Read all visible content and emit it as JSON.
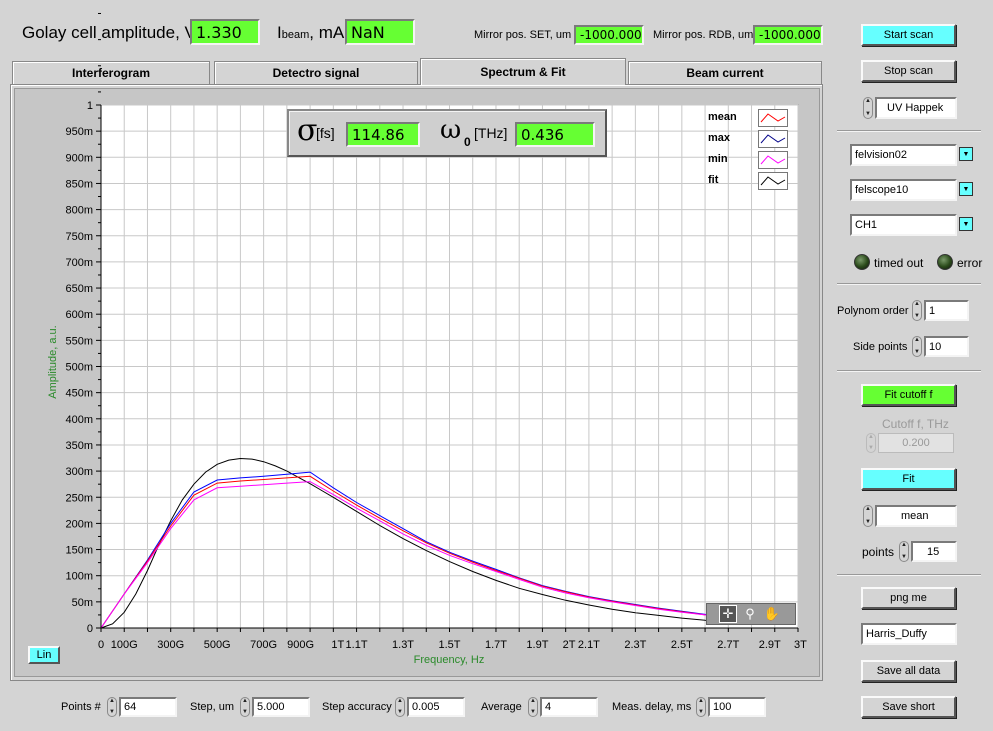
{
  "header": {
    "golay_label": "Golay cell amplitude, V",
    "golay_value": "1.330",
    "ibeam_main": "I",
    "ibeam_sub": "beam",
    "ibeam_unit": ", mA",
    "ibeam_value": "NaN",
    "mirror_set_label": "Mirror pos. SET, um",
    "mirror_set_value": "-1000.000",
    "mirror_rdb_label": "Mirror pos. RDB, um",
    "mirror_rdb_value": "-1000.000"
  },
  "tabs": [
    {
      "label": "Interferogram"
    },
    {
      "label": "Detectro signal"
    },
    {
      "label": "Spectrum & Fit"
    },
    {
      "label": "Beam current"
    }
  ],
  "fit_box": {
    "sigma_symbol": "σ",
    "sigma_unit": "[fs]",
    "sigma_value": "114.86",
    "omega_symbol": "ω",
    "omega_sub": "0",
    "omega_unit": "[THz]",
    "omega_value": "0.436"
  },
  "legend": [
    {
      "name": "mean",
      "color": "#ff0000"
    },
    {
      "name": "max",
      "color": "#0000ff"
    },
    {
      "name": "min",
      "color": "#ff00ff"
    },
    {
      "name": "fit",
      "color": "#000000"
    }
  ],
  "scale_button": "Lin",
  "chart_data": {
    "type": "line",
    "xlabel": "Frequency, Hz",
    "ylabel": "Amplitude, a.u.",
    "xlim": [
      0,
      3.0
    ],
    "ylim": [
      0,
      1.0
    ],
    "grid": true,
    "legend_position": "top-right",
    "x_ticks": [
      {
        "v": 0,
        "label": "0"
      },
      {
        "v": 0.1,
        "label": "100G"
      },
      {
        "v": 0.3,
        "label": "300G"
      },
      {
        "v": 0.5,
        "label": "500G"
      },
      {
        "v": 0.7,
        "label": "700G"
      },
      {
        "v": 0.9,
        "label": "900G"
      },
      {
        "v": 1.0,
        "label": "1T"
      },
      {
        "v": 1.1,
        "label": "1.1T"
      },
      {
        "v": 1.3,
        "label": "1.3T"
      },
      {
        "v": 1.5,
        "label": "1.5T"
      },
      {
        "v": 1.7,
        "label": "1.7T"
      },
      {
        "v": 1.9,
        "label": "1.9T"
      },
      {
        "v": 2.0,
        "label": "2T"
      },
      {
        "v": 2.1,
        "label": "2.1T"
      },
      {
        "v": 2.3,
        "label": "2.3T"
      },
      {
        "v": 2.5,
        "label": "2.5T"
      },
      {
        "v": 2.7,
        "label": "2.7T"
      },
      {
        "v": 2.9,
        "label": "2.9T"
      },
      {
        "v": 3.0,
        "label": "3T"
      }
    ],
    "y_ticks": [
      {
        "v": 0,
        "label": "0"
      },
      {
        "v": 0.05,
        "label": "50m"
      },
      {
        "v": 0.1,
        "label": "100m"
      },
      {
        "v": 0.15,
        "label": "150m"
      },
      {
        "v": 0.2,
        "label": "200m"
      },
      {
        "v": 0.25,
        "label": "250m"
      },
      {
        "v": 0.3,
        "label": "300m"
      },
      {
        "v": 0.35,
        "label": "350m"
      },
      {
        "v": 0.4,
        "label": "400m"
      },
      {
        "v": 0.45,
        "label": "450m"
      },
      {
        "v": 0.5,
        "label": "500m"
      },
      {
        "v": 0.55,
        "label": "550m"
      },
      {
        "v": 0.6,
        "label": "600m"
      },
      {
        "v": 0.65,
        "label": "650m"
      },
      {
        "v": 0.7,
        "label": "700m"
      },
      {
        "v": 0.75,
        "label": "750m"
      },
      {
        "v": 0.8,
        "label": "800m"
      },
      {
        "v": 0.85,
        "label": "850m"
      },
      {
        "v": 0.9,
        "label": "900m"
      },
      {
        "v": 0.95,
        "label": "950m"
      },
      {
        "v": 1.0,
        "label": "1"
      }
    ],
    "series": [
      {
        "name": "fit",
        "color": "#000000",
        "x": [
          0,
          0.05,
          0.1,
          0.15,
          0.2,
          0.25,
          0.3,
          0.35,
          0.4,
          0.45,
          0.5,
          0.55,
          0.6,
          0.65,
          0.7,
          0.75,
          0.8,
          0.85,
          0.9,
          0.95,
          1.0,
          1.1,
          1.2,
          1.3,
          1.4,
          1.5,
          1.6,
          1.7,
          1.8,
          1.9,
          2.0,
          2.1,
          2.2,
          2.3,
          2.4,
          2.5,
          2.6,
          2.7
        ],
        "y": [
          0,
          0.008,
          0.03,
          0.065,
          0.11,
          0.16,
          0.205,
          0.245,
          0.275,
          0.298,
          0.313,
          0.321,
          0.324,
          0.323,
          0.318,
          0.31,
          0.3,
          0.288,
          0.276,
          0.263,
          0.25,
          0.223,
          0.196,
          0.171,
          0.148,
          0.127,
          0.108,
          0.091,
          0.076,
          0.064,
          0.053,
          0.044,
          0.036,
          0.029,
          0.024,
          0.019,
          0.015,
          0.012
        ]
      },
      {
        "name": "max",
        "color": "#0000ff",
        "x": [
          0,
          0.1,
          0.2,
          0.3,
          0.4,
          0.5,
          0.6,
          0.7,
          0.8,
          0.9,
          1.0,
          1.1,
          1.2,
          1.3,
          1.4,
          1.5,
          1.6,
          1.7,
          1.8,
          1.9,
          2.0,
          2.1,
          2.2,
          2.3,
          2.4,
          2.5,
          2.6,
          2.7
        ],
        "y": [
          0,
          0.065,
          0.13,
          0.2,
          0.26,
          0.283,
          0.287,
          0.29,
          0.294,
          0.298,
          0.268,
          0.24,
          0.215,
          0.19,
          0.165,
          0.145,
          0.128,
          0.112,
          0.096,
          0.081,
          0.07,
          0.06,
          0.052,
          0.045,
          0.038,
          0.032,
          0.026,
          0.02
        ]
      },
      {
        "name": "mean",
        "color": "#ff0000",
        "x": [
          0,
          0.1,
          0.2,
          0.3,
          0.4,
          0.5,
          0.6,
          0.7,
          0.8,
          0.9,
          1.0,
          1.1,
          1.2,
          1.3,
          1.4,
          1.5,
          1.6,
          1.7,
          1.8,
          1.9,
          2.0,
          2.1,
          2.2,
          2.3,
          2.4,
          2.5,
          2.6,
          2.7
        ],
        "y": [
          0,
          0.065,
          0.128,
          0.195,
          0.254,
          0.277,
          0.281,
          0.284,
          0.287,
          0.29,
          0.262,
          0.235,
          0.21,
          0.186,
          0.163,
          0.143,
          0.126,
          0.11,
          0.095,
          0.08,
          0.069,
          0.059,
          0.051,
          0.044,
          0.037,
          0.031,
          0.025,
          0.02
        ]
      },
      {
        "name": "min",
        "color": "#ff00ff",
        "x": [
          0,
          0.1,
          0.2,
          0.3,
          0.4,
          0.5,
          0.6,
          0.7,
          0.8,
          0.9,
          1.0,
          1.1,
          1.2,
          1.3,
          1.4,
          1.5,
          1.6,
          1.7,
          1.8,
          1.9,
          2.0,
          2.1,
          2.2,
          2.3,
          2.4,
          2.5,
          2.6,
          2.7
        ],
        "y": [
          0,
          0.065,
          0.125,
          0.19,
          0.245,
          0.268,
          0.271,
          0.274,
          0.277,
          0.28,
          0.255,
          0.229,
          0.205,
          0.18,
          0.158,
          0.139,
          0.123,
          0.108,
          0.093,
          0.078,
          0.067,
          0.058,
          0.05,
          0.043,
          0.036,
          0.03,
          0.025,
          0.019
        ]
      }
    ]
  },
  "right_panel": {
    "start_scan": "Start scan",
    "stop_scan": "Stop scan",
    "mode_select": "UV Happek",
    "device1": "felvision02",
    "device2": "felscope10",
    "channel": "CH1",
    "led_timed_out": "timed out",
    "led_error": "error",
    "polynom_label": "Polynom order",
    "polynom_value": "1",
    "side_points_label": "Side points",
    "side_points_value": "10",
    "fit_cutoff_button": "Fit cutoff f",
    "cutoff_label": "Cutoff f, THz",
    "cutoff_value": "0.200",
    "fit_button": "Fit",
    "fit_mode": "mean",
    "points_label": "points",
    "points_value": "15",
    "png_button": "png me",
    "name_value": "Harris_Duffy",
    "save_all_button": "Save all data",
    "save_short_button": "Save short"
  },
  "bottom": {
    "points_label": "Points #",
    "points_value": "64",
    "step_label": "Step, um",
    "step_value": "5.000",
    "step_acc_label": "Step accuracy",
    "step_acc_value": "0.005",
    "average_label": "Average",
    "average_value": "4",
    "delay_label": "Meas. delay, ms",
    "delay_value": "100"
  }
}
